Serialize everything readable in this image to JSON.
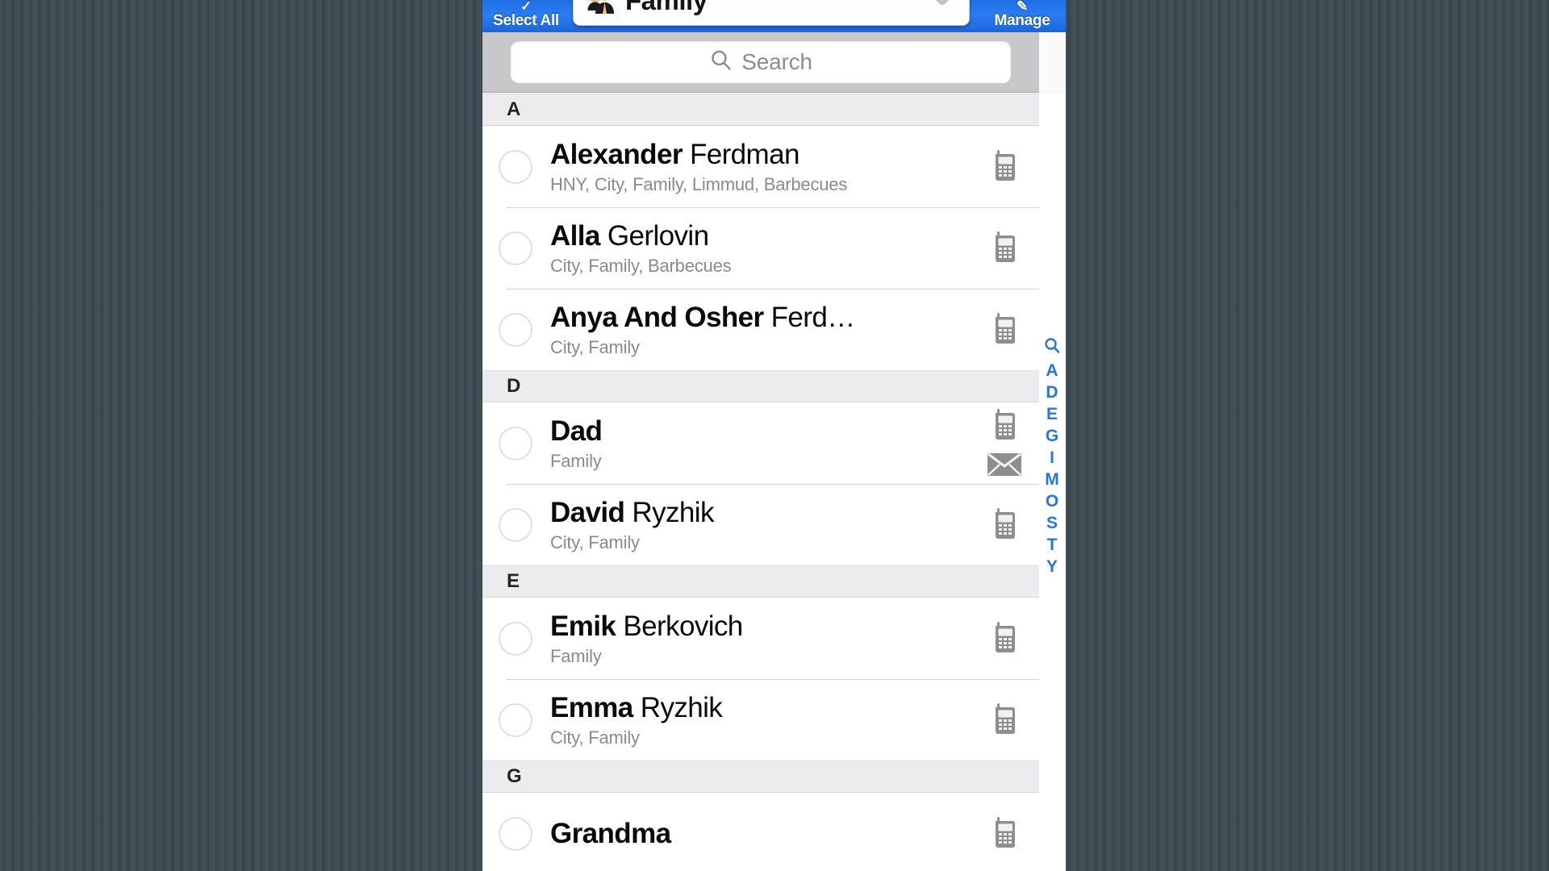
{
  "nav": {
    "select_all_label": "Select All",
    "manage_label": "Manage",
    "title": "Family",
    "title_icon": "group-people-icon",
    "chevron_icon": "chevron-down-icon",
    "select_all_icon": "checkmark-icon",
    "manage_icon": "tag-icon",
    "accent_blue": "#2a7cf0"
  },
  "search": {
    "placeholder": "Search",
    "value": "",
    "icon": "search-icon"
  },
  "list": {
    "sections": [
      {
        "letter": "A",
        "contacts": [
          {
            "first": "Alexander",
            "last": " Ferdman",
            "subtitle": "HNY, City, Family, Limmud, Barbecues",
            "icons": [
              "mobile-phone-icon"
            ],
            "checked": false
          },
          {
            "first": "Alla",
            "last": " Gerlovin",
            "subtitle": "City, Family, Barbecues",
            "icons": [
              "mobile-phone-icon"
            ],
            "checked": false
          },
          {
            "first": "Anya And Osher",
            "last": " Ferd…",
            "subtitle": "City, Family",
            "icons": [
              "mobile-phone-icon"
            ],
            "checked": false
          }
        ]
      },
      {
        "letter": "D",
        "contacts": [
          {
            "first": "Dad",
            "last": "",
            "subtitle": "Family",
            "icons": [
              "mobile-phone-icon",
              "envelope-icon"
            ],
            "checked": false
          },
          {
            "first": "David",
            "last": " Ryzhik",
            "subtitle": "City, Family",
            "icons": [
              "mobile-phone-icon"
            ],
            "checked": false
          }
        ]
      },
      {
        "letter": "E",
        "contacts": [
          {
            "first": "Emik",
            "last": " Berkovich",
            "subtitle": "Family",
            "icons": [
              "mobile-phone-icon"
            ],
            "checked": false
          },
          {
            "first": "Emma",
            "last": " Ryzhik",
            "subtitle": "City, Family",
            "icons": [
              "mobile-phone-icon"
            ],
            "checked": false
          }
        ]
      },
      {
        "letter": "G",
        "contacts": [
          {
            "first": "Grandma",
            "last": "",
            "subtitle": "",
            "icons": [
              "mobile-phone-icon"
            ],
            "checked": false
          }
        ]
      }
    ]
  },
  "alpha_index": {
    "color": "#2477e0",
    "items": [
      "🔍",
      "A",
      "D",
      "E",
      "G",
      "I",
      "M",
      "O",
      "S",
      "T",
      "Y"
    ]
  }
}
